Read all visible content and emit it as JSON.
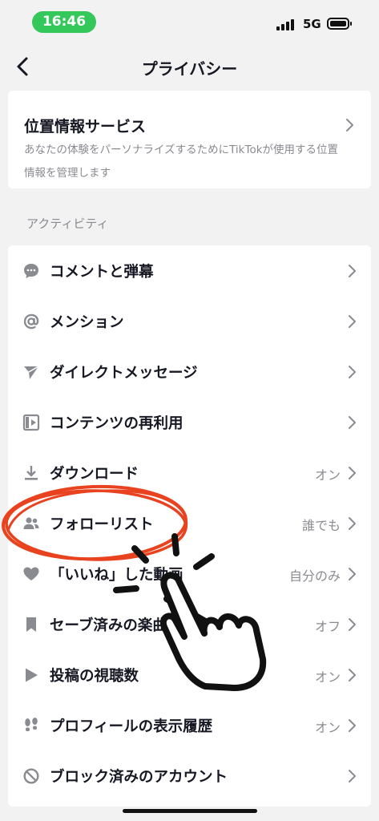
{
  "status_bar": {
    "time": "16:46",
    "network": "5G"
  },
  "nav": {
    "title": "プライバシー"
  },
  "location": {
    "title": "位置情報サービス",
    "description": "あなたの体験をパーソナライズするためにTikTokが使用する位置情報を管理します"
  },
  "activity": {
    "header": "アクティビティ",
    "rows": [
      {
        "label": "コメントと弾幕",
        "value": "",
        "icon": "comment-icon"
      },
      {
        "label": "メンション",
        "value": "",
        "icon": "at-icon"
      },
      {
        "label": "ダイレクトメッセージ",
        "value": "",
        "icon": "send-icon"
      },
      {
        "label": "コンテンツの再利用",
        "value": "",
        "icon": "reuse-icon"
      },
      {
        "label": "ダウンロード",
        "value": "オン",
        "icon": "download-icon"
      },
      {
        "label": "フォローリスト",
        "value": "誰でも",
        "icon": "people-icon"
      },
      {
        "label": "「いいね」した動画",
        "value": "自分のみ",
        "icon": "heart-icon"
      },
      {
        "label": "セーブ済みの楽曲",
        "value": "オフ",
        "icon": "bookmark-icon"
      },
      {
        "label": "投稿の視聴数",
        "value": "オン",
        "icon": "play-icon"
      },
      {
        "label": "プロフィールの表示履歴",
        "value": "オン",
        "icon": "footprints-icon"
      },
      {
        "label": "ブロック済みのアカウント",
        "value": "",
        "icon": "block-icon"
      }
    ]
  },
  "colors": {
    "annotation": "#e8421f",
    "background": "#f2f2f2",
    "text": "#161823",
    "secondary": "#8a8b91",
    "status_time": "#34c759"
  }
}
